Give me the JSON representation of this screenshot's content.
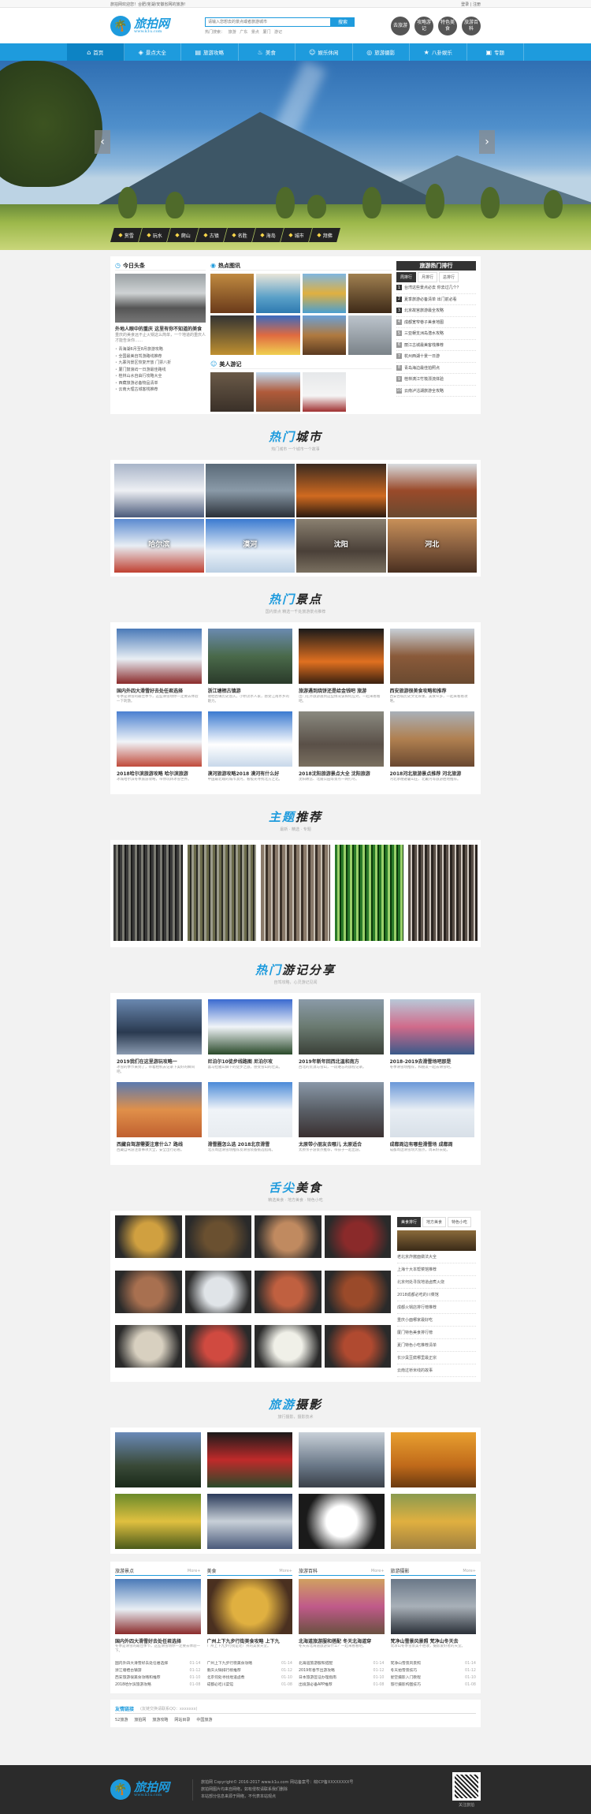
{
  "topbar": {
    "left": "旅拍网欢迎您！合肥/芜湖/安徽省网的旅游!",
    "login": "登录",
    "register": "注册"
  },
  "logo": {
    "text": "旅拍网",
    "url": "www.k1u.com"
  },
  "search": {
    "placeholder": "请输入您想去的景点或者旅游城市",
    "button": "搜索",
    "hot_label": "热门搜索：",
    "hot": [
      "旅游",
      "广东",
      "景点",
      "厦门",
      "游记"
    ]
  },
  "quick": [
    "去旅游",
    "攻略游记",
    "特色美食",
    "旅游百科"
  ],
  "nav": [
    {
      "label": "首页",
      "icon": "home-icon"
    },
    {
      "label": "景点大全",
      "icon": "map-icon"
    },
    {
      "label": "旅游攻略",
      "icon": "book-icon"
    },
    {
      "label": "美食",
      "icon": "food-icon"
    },
    {
      "label": "娱乐休闲",
      "icon": "fun-icon"
    },
    {
      "label": "旅游摄影",
      "icon": "camera-icon"
    },
    {
      "label": "八卦娱乐",
      "icon": "star-icon"
    },
    {
      "label": "专题",
      "icon": "topic-icon"
    }
  ],
  "banner_cats": [
    "赏雪",
    "玩水",
    "爬山",
    "古镇",
    "名胜",
    "海岛",
    "城市",
    "拜佛"
  ],
  "today": {
    "title": "今日头条",
    "headline": "外地人眼中的重庆 这里有你不知道的美食",
    "desc": "重庆的美食远不止火锅这么简单，一个地道的重庆人才能告诉你……",
    "list": [
      "青海湖6月至8月旅游攻略",
      "全国最美自驾游路线推荐",
      "九寨沟景区恢复开放 门票八折",
      "厦门鼓浪屿一日游最佳路线",
      "桂林山水自由行攻略大全",
      "西藏旅游必备物品清单",
      "云南大理古城客栈推荐"
    ]
  },
  "hotspot": {
    "title": "热点图讯",
    "sub_title": "美人游记"
  },
  "rank": {
    "title": "旅游热门排行",
    "tabs": [
      "周排行",
      "月排行",
      "总排行"
    ],
    "items": [
      "台湾这些景点必去 你去过几个？",
      "夏季旅游必备清单 出门前必看",
      "北京故宫旅游最全攻略",
      "成都宽窄巷子美食地图",
      "三亚蜈支洲岛潜水攻略",
      "丽江古城最美客栈推荐",
      "杭州西湖十景一日游",
      "青岛海边最佳拍照点",
      "桂林漓江竹筏漂流体验",
      "云南泸沽湖旅游全攻略"
    ]
  },
  "city_section": {
    "title_a": "热门",
    "title_b": "城市",
    "sub": "热门城市 一个城市一个故事"
  },
  "cities": [
    "",
    "",
    "",
    "",
    "哈尔滨",
    "漠河",
    "沈阳",
    "河北"
  ],
  "spot_section": {
    "title_a": "热门",
    "title_b": "景点",
    "sub": "国内景点 精选一千处旅游景点推荐"
  },
  "spots": [
    {
      "title": "国内外四大滑雪好去处任君选择",
      "desc": "冬季是滑雪的最佳季节，这些滑雪场你一定要去体验一下刺激。"
    },
    {
      "title": "浙江塘栖古镇游",
      "desc": "塘栖古镇历史悠久，小桥流水人家，感受江南水乡的魅力。"
    },
    {
      "title": "旅游遇到烧饼还是给金钱吧 旅游",
      "desc": "出门在外旅游遇到这些情况该如何应对，一起来看看吧。"
    },
    {
      "title": "西安旅游很美食攻略和推荐",
      "desc": "西安古城历史文化厚重，美食众多，一起来看看攻略。"
    },
    {
      "title": "2018哈尔滨旅游攻略 哈尔滨旅游",
      "desc": "冰城哈尔滨冬季旅游攻略，带你玩转冰雪世界。"
    },
    {
      "title": "漠河旅游攻略2018 漠河有什么好",
      "desc": "中国最北端的城市漠河，看极光寻找北方之北。"
    },
    {
      "title": "2018沈阳旅游景点大全 沈阳旅游",
      "desc": "沈阳故宫、北陵公园等景点一网打尽。"
    },
    {
      "title": "2018河北旅游景点推荐 河北旅游",
      "desc": "河北承德避暑山庄、北戴河等旅游胜地推荐。"
    }
  ],
  "topic_section": {
    "title_a": "主题",
    "title_b": "推荐",
    "sub": "最新 · 精选 · 专题"
  },
  "notes_section": {
    "title_a": "热门",
    "title_b": "游记分享",
    "sub": "自驾攻略，心灵游记见闻"
  },
  "notes": [
    {
      "title": "2019我们在这里游玩攻略一",
      "desc": "冰雪的季节来到了，带着相机去记录下美好的瞬间吧。"
    },
    {
      "title": "尼泊尔10徒步线路图 尼泊尔攻",
      "desc": "喜马拉雅山脚下的徒步之旅，感受雪山的壮美。"
    },
    {
      "title": "2019年新年回西北温和南方",
      "desc": "西北的荒漠与雪山，一段难忘的旅程记录。"
    },
    {
      "title": "2018-2019去滑雪场吧那是",
      "desc": "冬季滑雪场推荐，和朋友一起去滑雪吧。"
    },
    {
      "title": "西藏自驾游需要注意什么？路线",
      "desc": "西藏自驾游注意事项大全，安全出行必看。"
    },
    {
      "title": "滑雪圈怎么选 2018北京滑雪",
      "desc": "北京周边滑雪场推荐及滑雪装备挑选指南。"
    },
    {
      "title": "太原带小朋友去哪儿 太原适合",
      "desc": "太原亲子游景点推荐，带孩子一起出游。"
    },
    {
      "title": "成都周边有哪些滑雪场 成都周",
      "desc": "成都周边滑雪场大盘点，周末好去处。"
    }
  ],
  "food_section": {
    "title_a": "舌尖",
    "title_b": "美食",
    "sub": "精选美食 · 地方美食 · 特色小吃"
  },
  "food_tabs": [
    "美食排行",
    "地方美食",
    "特色小吃"
  ],
  "food_list": [
    "老北京炸酱面做法大全",
    "上海十大本帮菜馆推荐",
    "北京何处寻找地道卤煮火烧",
    "2018成都必吃的川菜馆",
    "成都火锅店排行榜推荐",
    "重庆小面哪家最好吃",
    "厦门特色美食排行榜",
    "夏门特色小吃推荐清单",
    "长沙臭豆腐哪里最正宗",
    "云南过桥米线的故事"
  ],
  "photo_section": {
    "title_a": "旅游",
    "title_b": "摄影",
    "sub": "旅行摄影，摄影技术"
  },
  "bottom": [
    {
      "head": "旅游景点",
      "more": "More+",
      "title": "国内外四大滑雪好去处任君选择",
      "desc": "冬季是滑雪的最佳季节，这些滑雪场你一定要去体验一下。",
      "list": [
        [
          "国内外四大滑雪好去处任君选择",
          "01-14"
        ],
        [
          "浙江塘栖古镇游",
          "01-12"
        ],
        [
          "西安旅游很美食攻略和推荐",
          "01-10"
        ],
        [
          "2018哈尔滨旅游攻略",
          "01-08"
        ]
      ]
    },
    {
      "head": "美食",
      "more": "More+",
      "title": "广州上下九步行街美食攻略 上下九",
      "desc": "广州上下九步行街是老广州的美食天堂。",
      "list": [
        [
          "广州上下九步行街美食攻略",
          "01-14"
        ],
        [
          "重庆火锅排行榜推荐",
          "01-12"
        ],
        [
          "北京何处寻找地道卤煮",
          "01-10"
        ],
        [
          "成都必吃川菜馆",
          "01-08"
        ]
      ]
    },
    {
      "head": "旅游百科",
      "more": "More+",
      "title": "北海道旅游服和搭配 冬天北海道穿",
      "desc": "冬天去北海道旅游穿什么？一起来看看吧。",
      "list": [
        [
          "北海道旅游服和搭配",
          "01-14"
        ],
        [
          "2019年春节出游攻略",
          "01-12"
        ],
        [
          "日本旅游签证办理指南",
          "01-10"
        ],
        [
          "出境游必备APP推荐",
          "01-08"
        ]
      ]
    },
    {
      "head": "旅游摄影",
      "more": "More+",
      "title": "梵净山雪景风景照 梵净山冬天去",
      "desc": "梵净山冬季雪景美不胜收，摄影爱好者的天堂。",
      "list": [
        [
          "梵净山雪景风景照",
          "01-14"
        ],
        [
          "冬天拍雪景技巧",
          "01-12"
        ],
        [
          "星空摄影入门教程",
          "01-10"
        ],
        [
          "旅行摄影构图技巧",
          "01-08"
        ]
      ]
    }
  ],
  "links": {
    "title": "友情链接",
    "note": "(友链交换请联系QQ：xxxxxxx)",
    "items": [
      "52旅游",
      "旅拍网",
      "旅游攻略",
      "网站目录",
      "中国旅游"
    ]
  },
  "footer": {
    "lines": [
      "旅拍网 Copyright© 2016-2017 www.k1u.com 网站备案号：皖ICP备XXXXXXXX号",
      "旅拍网图片均来自网络，如有侵权请联系我们删除",
      "本站部分信息来源于网络，不代表本站观点"
    ],
    "qr_label": "关注旅拍"
  },
  "colors": {
    "brand": "#1e9bdd",
    "dark": "#2b2b2b"
  }
}
